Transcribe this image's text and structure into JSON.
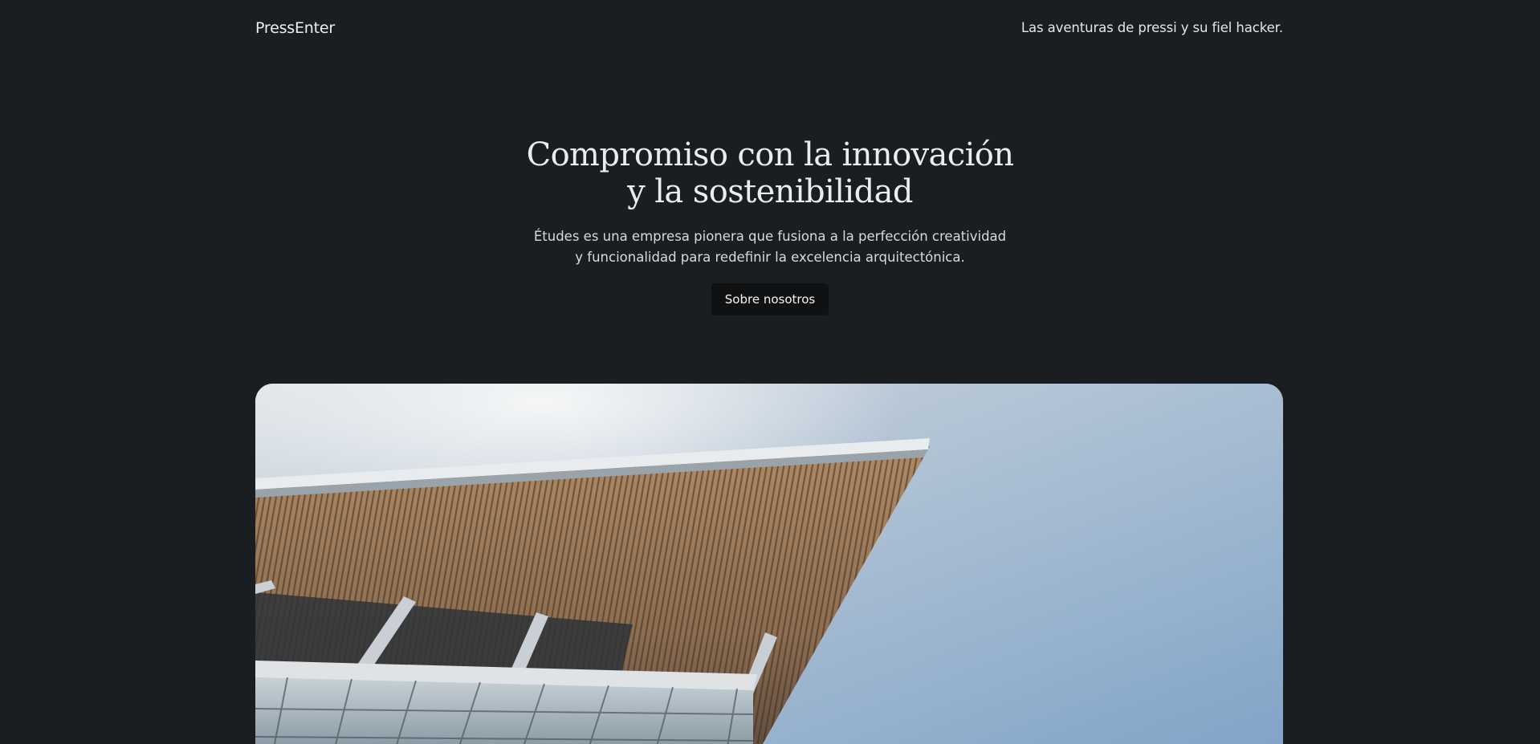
{
  "header": {
    "site_title": "PressEnter",
    "tagline": "Las aventuras de pressi y su fiel hacker."
  },
  "hero": {
    "title_line1": "Compromiso con la innovación",
    "title_line2": "y la sostenibilidad",
    "description_line1": "Études es una empresa pionera que fusiona a la perfección creatividad",
    "description_line2": "y funcionalidad para redefinir la excelencia arquitectónica.",
    "button_label": "Sobre nosotros"
  },
  "colors": {
    "background": "#1b1e20",
    "button_background": "#0f1112",
    "text": "#e9e9e9"
  }
}
